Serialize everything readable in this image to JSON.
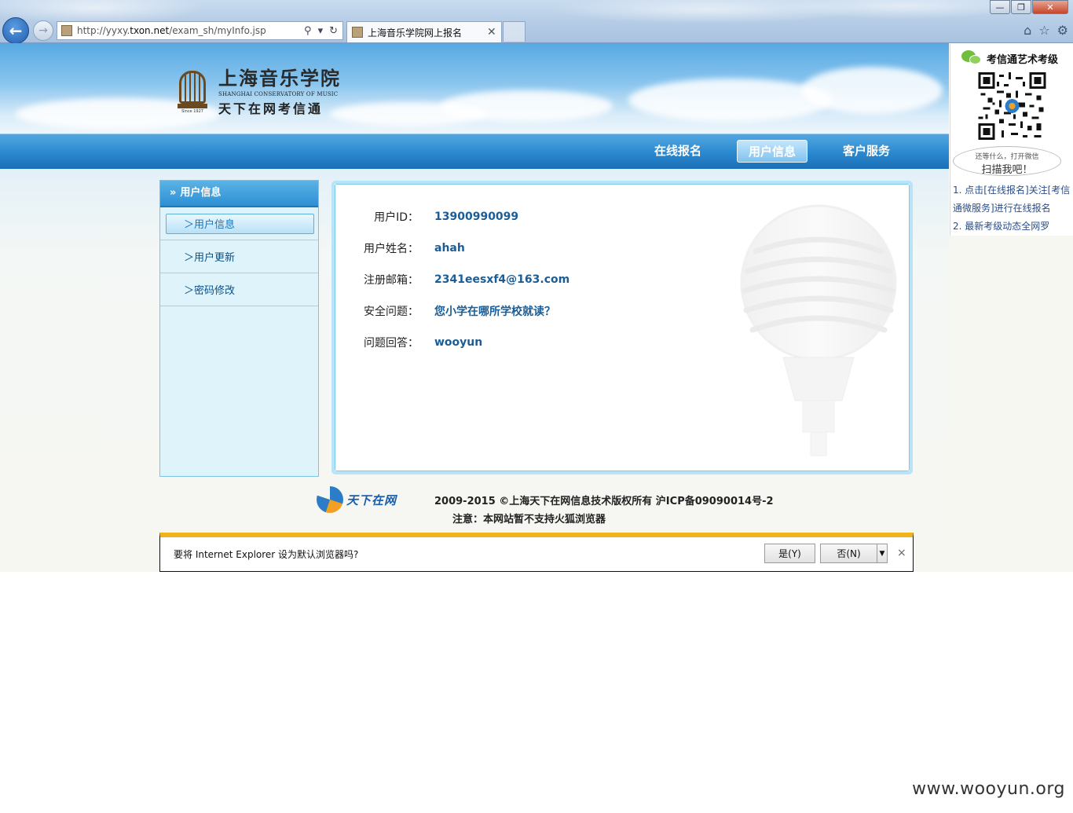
{
  "browser": {
    "url_prefix": "http://yyxy.",
    "url_domain": "txon.net",
    "url_path": "/exam_sh/myInfo.jsp",
    "tab_title": "上海音乐学院网上报名",
    "min_label": "—",
    "restore_label": "❐",
    "close_label": "✕",
    "back_label": "←",
    "forward_label": "→",
    "tab_close_label": "✕",
    "search_icon": "⚲",
    "dropdown_icon": "▾",
    "refresh_icon": "↻",
    "home_icon": "⌂",
    "star_icon": "☆",
    "gear_icon": "⚙"
  },
  "header": {
    "logo_cn": "上海音乐学院",
    "logo_en": "SHANGHAI CONSERVATORY OF MUSIC",
    "logo_sub": "天下在网考信通",
    "logo_since": "Since 1927"
  },
  "nav": {
    "items": [
      {
        "label": "在线报名"
      },
      {
        "label": "用户信息"
      },
      {
        "label": "客户服务"
      }
    ],
    "active_index": 1
  },
  "sidebar": {
    "header_icon": "»",
    "header": "用户信息",
    "items": [
      {
        "label": "＞用户信息"
      },
      {
        "label": "＞用户更新"
      },
      {
        "label": "＞密码修改"
      }
    ]
  },
  "info": {
    "rows": [
      {
        "label": "用户ID：",
        "value": "13900990099"
      },
      {
        "label": "用户姓名：",
        "value": "ahah"
      },
      {
        "label": "注册邮箱：",
        "value": "2341eesxf4@163.com"
      },
      {
        "label": "安全问题：",
        "value": "您小学在哪所学校就读？"
      },
      {
        "label": "问题回答：",
        "value": "wooyun"
      }
    ]
  },
  "footer": {
    "brand": "天下在网",
    "copyright": "2009-2015 ©上海天下在网信息技术版权所有 沪ICP备09090014号-2",
    "note": "注意：本网站暂不支持火狐浏览器"
  },
  "ie_notice": {
    "text": "要将 Internet Explorer 设为默认浏览器吗?",
    "yes": "是(Y)",
    "no": "否(N)",
    "dropdown_icon": "▼",
    "close_icon": "×"
  },
  "ad": {
    "title": "考信通艺术考级",
    "bubble_line1": "还等什么，打开微信",
    "bubble_line2": "扫描我吧！",
    "items": [
      "1. 点击[在线报名]关注[考信通微服务]进行在线报名",
      "2. 最新考级动态全网罗"
    ]
  },
  "watermark": "www.wooyun.org"
}
